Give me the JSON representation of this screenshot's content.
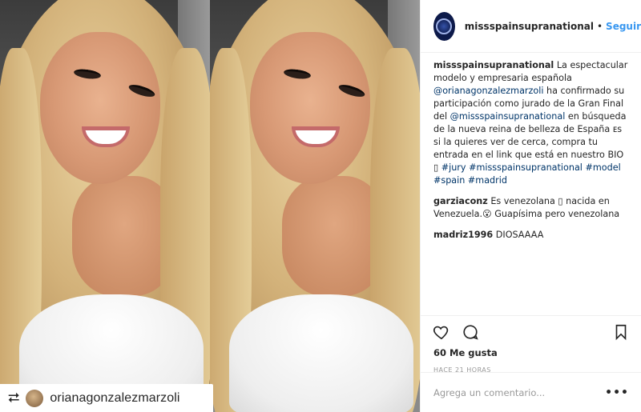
{
  "post": {
    "repost": {
      "icon": "repost-icon",
      "username": "orianagonzalezmarzoli"
    }
  },
  "header": {
    "username": "missspainsupranational",
    "dot": "•",
    "follow_label": "Seguir"
  },
  "caption": {
    "username": "missspainsupranational",
    "text_1": " La espectacular modelo y empresaria española ",
    "mention_1": "@orianagonzalezmarzoli",
    "text_2": " ha confirmado su participación como jurado de la Gran Final del ",
    "mention_2": "@missspainsupranational",
    "text_3": " en búsqueda de la nueva reina de belleza de España ᴇs si la quieres ver de cerca, compra tu entrada en el link que está en nuestro BIO ▯ ",
    "tag_1": "#jury",
    "tag_2": "#missspainsupranational",
    "tag_3": "#model",
    "tag_4": "#spain",
    "tag_5": "#madrid"
  },
  "comments": [
    {
      "username": "garziaconz",
      "text": " Es venezolana ▯ nacida en Venezuela.😮 Guapísima pero venezolana"
    },
    {
      "username": "madriz1996",
      "text": " DIOSAAAA"
    }
  ],
  "actions": {
    "like_icon": "heart-icon",
    "comment_icon": "comment-icon",
    "save_icon": "bookmark-icon",
    "likes_text": "60 Me gusta",
    "time_text": "HACE 21 HORAS"
  },
  "add_comment": {
    "placeholder": "Agrega un comentario...",
    "more_label": "•••"
  }
}
